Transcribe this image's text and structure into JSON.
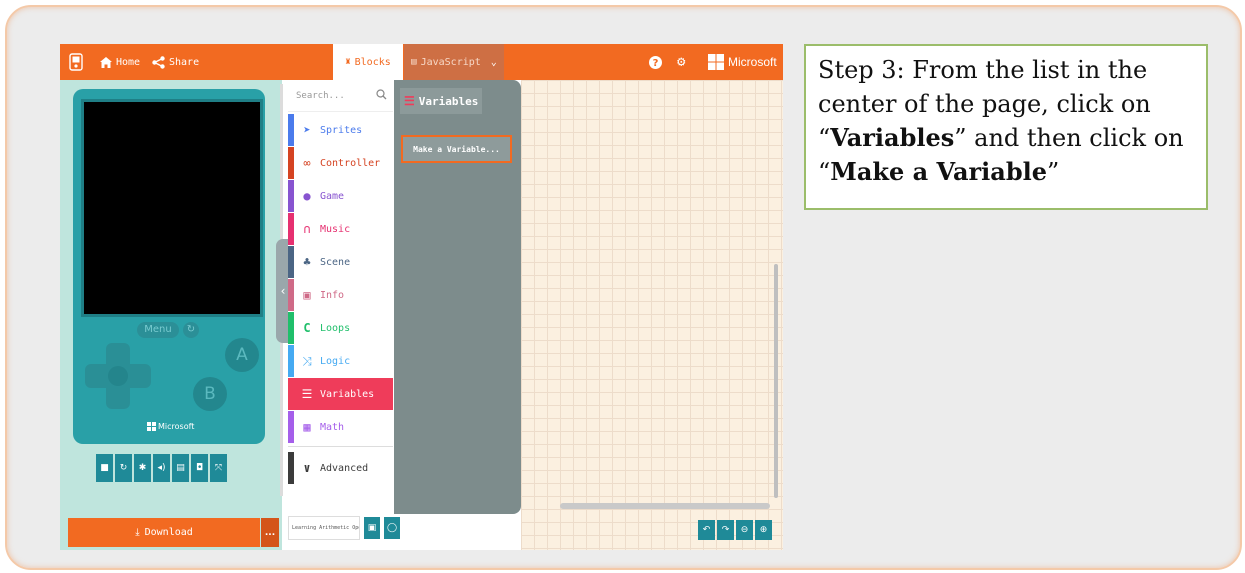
{
  "topbar": {
    "home_label": "Home",
    "share_label": "Share",
    "tab_blocks": "Blocks",
    "tab_javascript": "JavaScript",
    "brand": "Microsoft",
    "color": "#f26a21"
  },
  "simulator": {
    "menu_label": "Menu",
    "button_a": "A",
    "button_b": "B",
    "brand": "Microsoft",
    "download_label": "Download",
    "download_more": "..."
  },
  "toolbox": {
    "search_placeholder": "Search...",
    "categories": [
      {
        "label": "Sprites",
        "icon": "paper-plane-icon",
        "color": "#4b7bec"
      },
      {
        "label": "Controller",
        "icon": "gamepad-icon",
        "color": "#d54322"
      },
      {
        "label": "Game",
        "icon": "circle-icon",
        "color": "#8854d0"
      },
      {
        "label": "Music",
        "icon": "headphones-icon",
        "color": "#e63070"
      },
      {
        "label": "Scene",
        "icon": "tree-icon",
        "color": "#4b6584"
      },
      {
        "label": "Info",
        "icon": "id-card-icon",
        "color": "#cf6a87"
      },
      {
        "label": "Loops",
        "icon": "loop-icon",
        "color": "#20bf6b"
      },
      {
        "label": "Logic",
        "icon": "shuffle-icon",
        "color": "#45aaf2"
      },
      {
        "label": "Variables",
        "icon": "list-icon",
        "color": "#ef3c5a",
        "selected": true
      },
      {
        "label": "Math",
        "icon": "calculator-icon",
        "color": "#a55eea"
      },
      {
        "label": "Advanced",
        "icon": "chevron-down-icon",
        "color": "#3b3b3b"
      }
    ]
  },
  "flyout": {
    "title": "Variables",
    "make_variable": "Make a Variable..."
  },
  "bottom": {
    "project_name": "Learning Arithmetic Ope"
  },
  "instruction": {
    "prefix": "Step 3: From the list in the center of the page, click on “",
    "bold1": "Variables",
    "middle": "” and then click on “",
    "bold2": "Make a Variable",
    "suffix": "”"
  }
}
